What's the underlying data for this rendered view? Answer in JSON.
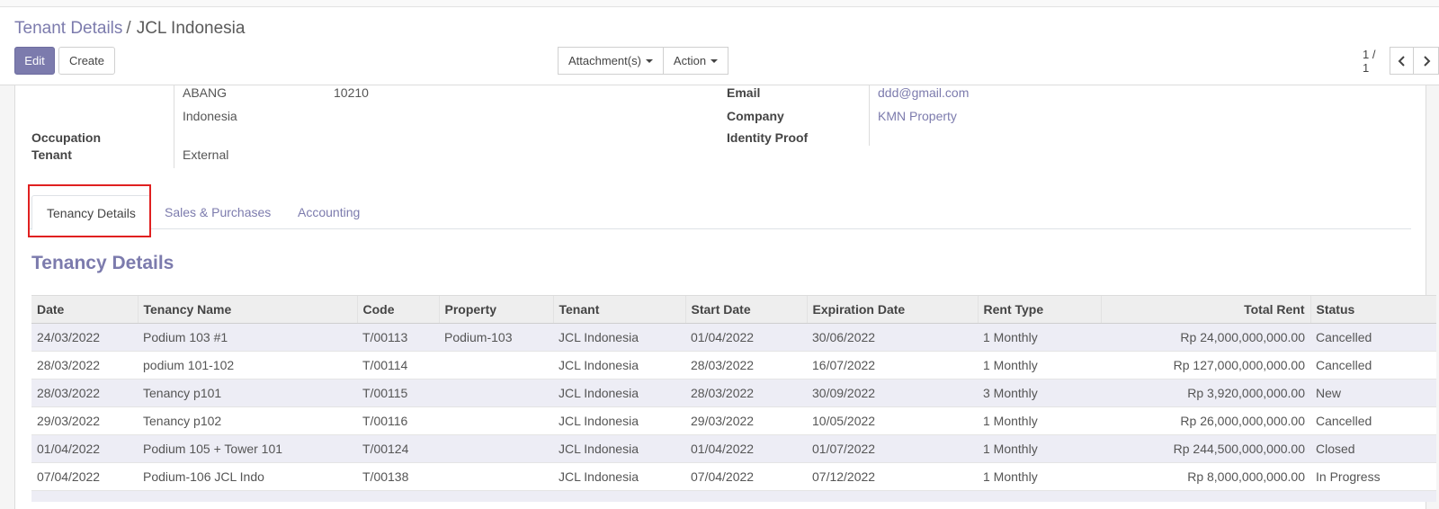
{
  "breadcrumb": {
    "parent": "Tenant Details",
    "separator": "/",
    "current": "JCL Indonesia"
  },
  "buttons": {
    "edit": "Edit",
    "create": "Create",
    "attachments": "Attachment(s)",
    "action": "Action"
  },
  "pager": {
    "value": "1 / 1"
  },
  "form": {
    "address_line": "ABANG",
    "zip": "10210",
    "country": "Indonesia",
    "occupation_label_1": "Occupation",
    "occupation_label_2": "Tenant",
    "occupation_value": "External",
    "email_label": "Email",
    "email_value": "ddd@gmail.com",
    "company_label": "Company",
    "company_value": "KMN Property",
    "identity_label": "Identity Proof"
  },
  "tabs": [
    "Tenancy Details",
    "Sales & Purchases",
    "Accounting"
  ],
  "section_title": "Tenancy Details",
  "table": {
    "headers": [
      "Date",
      "Tenancy Name",
      "Code",
      "Property",
      "Tenant",
      "Start Date",
      "Expiration Date",
      "Rent Type",
      "Total Rent",
      "Status"
    ],
    "rows": [
      [
        "24/03/2022",
        "Podium 103 #1",
        "T/00113",
        "Podium-103",
        "JCL Indonesia",
        "01/04/2022",
        "30/06/2022",
        "1 Monthly",
        "Rp 24,000,000,000.00",
        "Cancelled"
      ],
      [
        "28/03/2022",
        "podium 101-102",
        "T/00114",
        "",
        "JCL Indonesia",
        "28/03/2022",
        "16/07/2022",
        "1 Monthly",
        "Rp 127,000,000,000.00",
        "Cancelled"
      ],
      [
        "28/03/2022",
        "Tenancy p101",
        "T/00115",
        "",
        "JCL Indonesia",
        "28/03/2022",
        "30/09/2022",
        "3 Monthly",
        "Rp 3,920,000,000.00",
        "New"
      ],
      [
        "29/03/2022",
        "Tenancy p102",
        "T/00116",
        "",
        "JCL Indonesia",
        "29/03/2022",
        "10/05/2022",
        "1 Monthly",
        "Rp 26,000,000,000.00",
        "Cancelled"
      ],
      [
        "01/04/2022",
        "Podium 105 + Tower 101",
        "T/00124",
        "",
        "JCL Indonesia",
        "01/04/2022",
        "01/07/2022",
        "1 Monthly",
        "Rp 244,500,000,000.00",
        "Closed"
      ],
      [
        "07/04/2022",
        "Podium-106 JCL Indo",
        "T/00138",
        "",
        "JCL Indonesia",
        "07/04/2022",
        "07/12/2022",
        "1 Monthly",
        "Rp 8,000,000,000.00",
        "In Progress"
      ]
    ]
  },
  "colors": {
    "accent": "#7c7bad",
    "highlight": "#e02020",
    "row_alt": "#ededf5"
  }
}
